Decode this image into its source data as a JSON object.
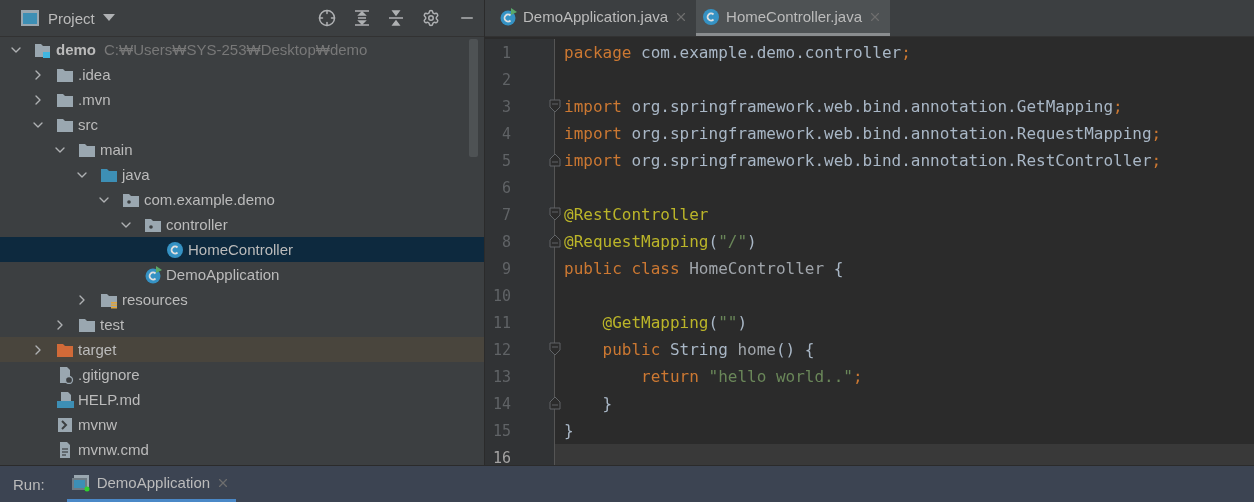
{
  "project_panel": {
    "title": "Project",
    "tree": [
      {
        "name": "demo",
        "path": "C:₩Users₩SYS-253₩Desktop₩demo",
        "kind": "module",
        "expanded": true,
        "selected": false,
        "excluded": false,
        "children": [
          {
            "name": ".idea",
            "kind": "folder",
            "expanded": false,
            "selected": false,
            "excluded": false
          },
          {
            "name": ".mvn",
            "kind": "folder",
            "expanded": false,
            "selected": false,
            "excluded": false
          },
          {
            "name": "src",
            "kind": "folder",
            "expanded": true,
            "selected": false,
            "excluded": false,
            "children": [
              {
                "name": "main",
                "kind": "folder",
                "expanded": true,
                "selected": false,
                "excluded": false,
                "children": [
                  {
                    "name": "java",
                    "kind": "source",
                    "expanded": true,
                    "selected": false,
                    "excluded": false,
                    "children": [
                      {
                        "name": "com.example.demo",
                        "kind": "package",
                        "expanded": true,
                        "selected": false,
                        "excluded": false,
                        "children": [
                          {
                            "name": "controller",
                            "kind": "package",
                            "expanded": true,
                            "selected": false,
                            "excluded": false,
                            "children": [
                              {
                                "name": "HomeController",
                                "kind": "class",
                                "selected": true,
                                "excluded": false
                              }
                            ]
                          },
                          {
                            "name": "DemoApplication",
                            "kind": "app",
                            "selected": false,
                            "excluded": false
                          }
                        ]
                      }
                    ]
                  },
                  {
                    "name": "resources",
                    "kind": "resources",
                    "expanded": false,
                    "selected": false,
                    "excluded": false
                  }
                ]
              },
              {
                "name": "test",
                "kind": "folder",
                "expanded": false,
                "selected": false,
                "excluded": false
              }
            ]
          },
          {
            "name": "target",
            "kind": "folder",
            "expanded": false,
            "selected": false,
            "excluded": true
          },
          {
            "name": ".gitignore",
            "kind": "ignore",
            "selected": false,
            "excluded": false
          },
          {
            "name": "HELP.md",
            "kind": "markdown",
            "selected": false,
            "excluded": false
          },
          {
            "name": "mvnw",
            "kind": "script",
            "selected": false,
            "excluded": false
          },
          {
            "name": "mvnw.cmd",
            "kind": "text",
            "selected": false,
            "excluded": false
          }
        ]
      }
    ]
  },
  "editor": {
    "tabs": [
      {
        "label": "DemoApplication.java",
        "kind": "app",
        "selected": false
      },
      {
        "label": "HomeController.java",
        "kind": "class",
        "selected": true
      }
    ],
    "lines": [
      {
        "number": "1",
        "kind": "plain",
        "current": false,
        "tokens": [
          {
            "text": "package",
            "kind": "kw"
          },
          {
            "text": " com.example.demo.controller",
            "kind": "plain"
          },
          {
            "text": ";",
            "kind": "kw"
          }
        ]
      },
      {
        "number": "2",
        "kind": "plain",
        "current": false
      },
      {
        "number": "3",
        "kind": "fold-start",
        "current": false,
        "tokens": [
          {
            "text": "import",
            "kind": "kw"
          },
          {
            "text": " org.springframework.web.bind.annotation.GetMapping",
            "kind": "plain"
          },
          {
            "text": ";",
            "kind": "kw"
          }
        ]
      },
      {
        "number": "4",
        "kind": "plain",
        "current": false,
        "tokens": [
          {
            "text": "import",
            "kind": "kw"
          },
          {
            "text": " org.springframework.web.bind.annotation.RequestMapping",
            "kind": "plain"
          },
          {
            "text": ";",
            "kind": "kw"
          }
        ]
      },
      {
        "number": "5",
        "kind": "fold-end",
        "current": false,
        "tokens": [
          {
            "text": "import",
            "kind": "kw"
          },
          {
            "text": " org.springframework.web.bind.annotation.RestController",
            "kind": "plain"
          },
          {
            "text": ";",
            "kind": "kw"
          }
        ]
      },
      {
        "number": "6",
        "kind": "plain",
        "current": false
      },
      {
        "number": "7",
        "kind": "fold-start",
        "current": false,
        "tokens": [
          {
            "text": "@RestController",
            "kind": "ann"
          }
        ]
      },
      {
        "number": "8",
        "kind": "fold-end",
        "current": false,
        "tokens": [
          {
            "text": "@RequestMapping",
            "kind": "ann"
          },
          {
            "text": "(",
            "kind": "plain"
          },
          {
            "text": "\"/\"",
            "kind": "str"
          },
          {
            "text": ")",
            "kind": "plain"
          }
        ]
      },
      {
        "number": "9",
        "kind": "plain",
        "current": false,
        "tokens": [
          {
            "text": "public class ",
            "kind": "kw"
          },
          {
            "text": "HomeController",
            "kind": "dim"
          },
          {
            "text": " {",
            "kind": "plain"
          }
        ]
      },
      {
        "number": "10",
        "kind": "plain",
        "current": false
      },
      {
        "number": "11",
        "kind": "plain",
        "current": false,
        "tokens": [
          {
            "text": "    @GetMapping",
            "kind": "ann"
          },
          {
            "text": "(",
            "kind": "plain"
          },
          {
            "text": "\"\"",
            "kind": "str"
          },
          {
            "text": ")",
            "kind": "plain"
          }
        ]
      },
      {
        "number": "12",
        "kind": "fold-start",
        "current": false,
        "tokens": [
          {
            "text": "    public ",
            "kind": "kw"
          },
          {
            "text": "String ",
            "kind": "plain"
          },
          {
            "text": "home",
            "kind": "dim"
          },
          {
            "text": "() {",
            "kind": "plain"
          }
        ]
      },
      {
        "number": "13",
        "kind": "plain",
        "current": false,
        "tokens": [
          {
            "text": "        return ",
            "kind": "kw"
          },
          {
            "text": "\"hello world..\"",
            "kind": "str"
          },
          {
            "text": ";",
            "kind": "kw"
          }
        ]
      },
      {
        "number": "14",
        "kind": "fold-end",
        "current": false,
        "tokens": [
          {
            "text": "    }",
            "kind": "plain"
          }
        ]
      },
      {
        "number": "15",
        "kind": "plain",
        "current": false,
        "tokens": [
          {
            "text": "}",
            "kind": "plain"
          }
        ]
      },
      {
        "number": "16",
        "kind": "plain",
        "current": true
      }
    ]
  },
  "run_bar": {
    "label": "Run:",
    "tabs": [
      {
        "label": "DemoApplication",
        "selected": true
      }
    ]
  }
}
